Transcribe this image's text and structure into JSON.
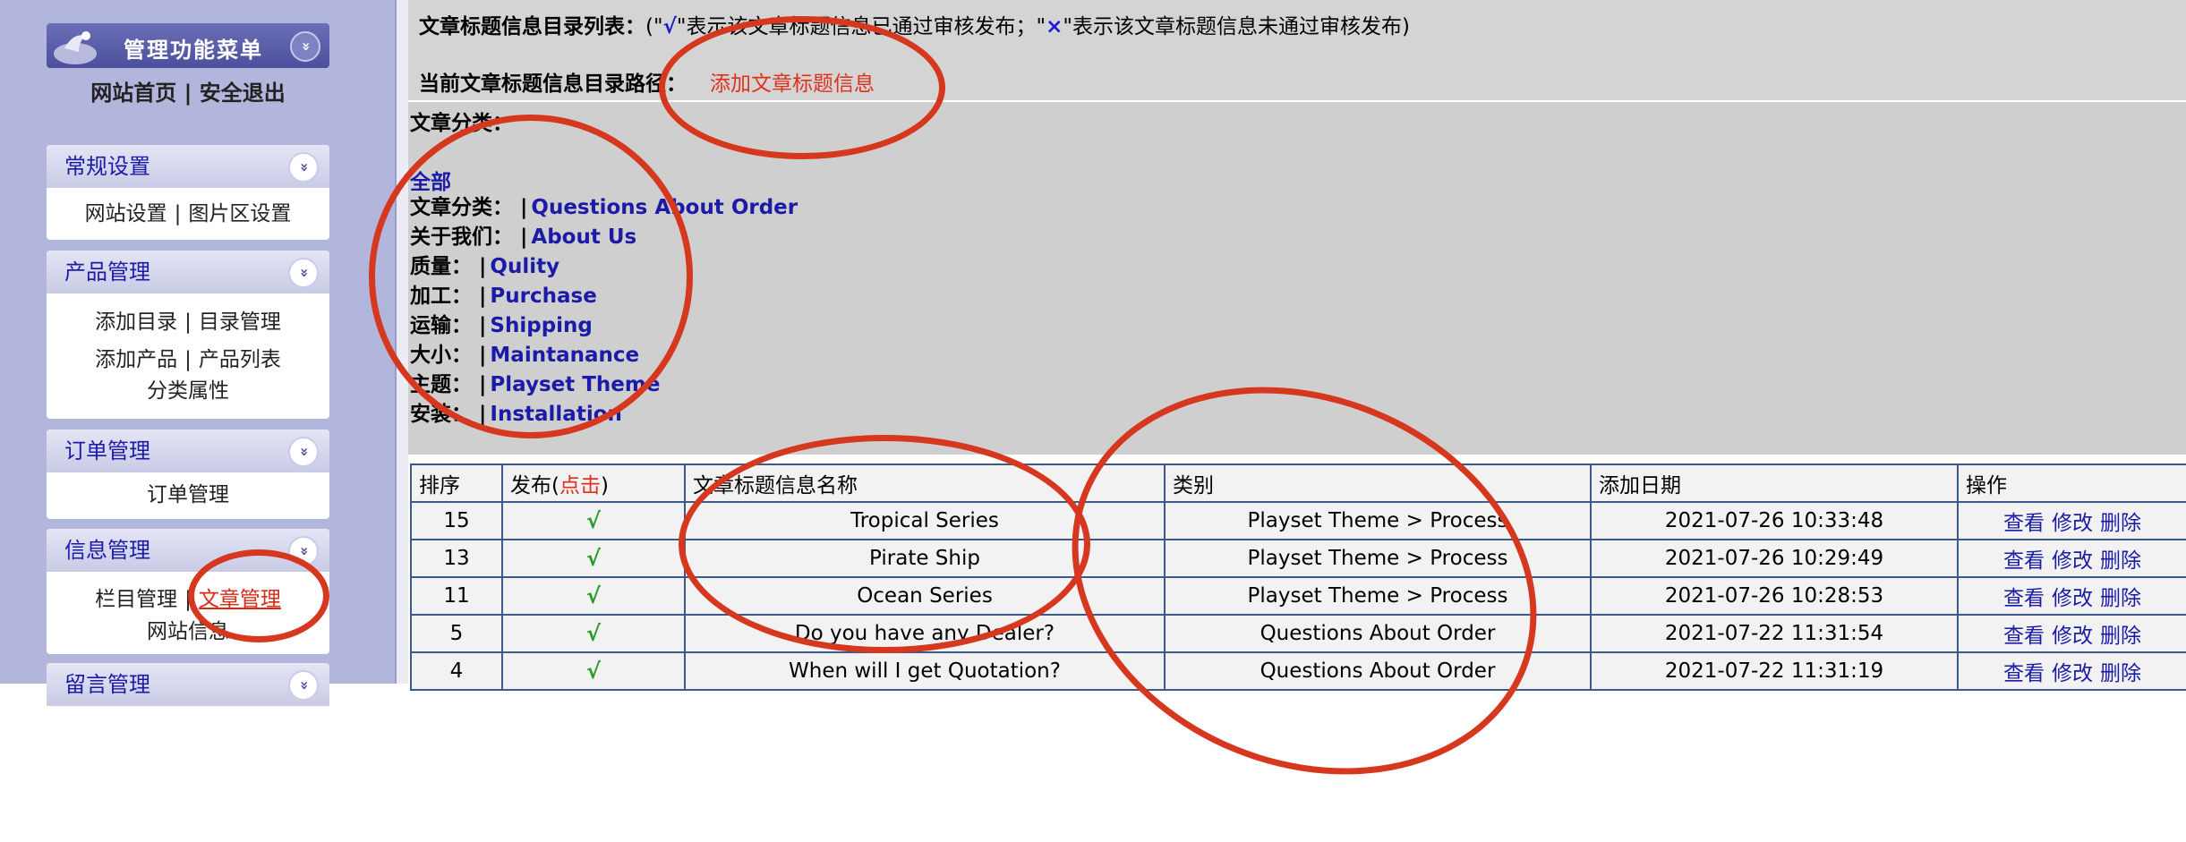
{
  "sidebar": {
    "header_title": "管理功能菜单",
    "home_link": "网站首页",
    "link_separator": "|",
    "logout_link": "安全退出",
    "sections": {
      "general": {
        "title": "常规设置",
        "links": [
          "网站设置",
          "图片区设置"
        ]
      },
      "product": {
        "title": "产品管理",
        "row1": [
          "添加目录",
          "目录管理"
        ],
        "row2": [
          "添加产品",
          "产品列表"
        ],
        "row3": "分类属性"
      },
      "order": {
        "title": "订单管理",
        "link": "订单管理"
      },
      "info": {
        "title": "信息管理",
        "links": [
          "栏目管理",
          "文章管理"
        ],
        "row2": "网站信息"
      },
      "message": {
        "title": "留言管理"
      }
    },
    "chevron": "»"
  },
  "main": {
    "legend": {
      "label": "文章标题信息目录列表：",
      "open_paren": "(\"",
      "check": "√",
      "text1": "\"表示该文章标题信息已通过审核发布；\"",
      "cross": "×",
      "text2": "\"表示该文章标题信息未通过审核发布)"
    },
    "path": {
      "label": "当前文章标题信息目录路径：",
      "add_link": "添加文章标题信息"
    },
    "categories": {
      "title": "文章分类：",
      "all": "全部",
      "rows": [
        {
          "name": "文章分类：",
          "link": "Questions About Order"
        },
        {
          "name": "关于我们：",
          "link": "About Us"
        },
        {
          "name": "质量：",
          "link": "Qulity"
        },
        {
          "name": "加工：",
          "link": "Purchase"
        },
        {
          "name": "运输：",
          "link": "Shipping"
        },
        {
          "name": "大小：",
          "link": "Maintanance"
        },
        {
          "name": "主题：",
          "link": "Playset Theme"
        },
        {
          "name": "安装：",
          "link": "Installation"
        }
      ],
      "bar": "|"
    },
    "table": {
      "headers": {
        "order": "排序",
        "publish": "发布(",
        "publish_click": "点击",
        "publish_close": ")",
        "title": "文章标题信息名称",
        "category": "类别",
        "date": "添加日期",
        "ops": "操作"
      },
      "rows": [
        {
          "order": "15",
          "published": "√",
          "title": "Tropical Series",
          "category": "Playset Theme > Process",
          "date": "2021-07-26 10:33:48"
        },
        {
          "order": "13",
          "published": "√",
          "title": "Pirate Ship",
          "category": "Playset Theme > Process",
          "date": "2021-07-26 10:29:49"
        },
        {
          "order": "11",
          "published": "√",
          "title": "Ocean Series",
          "category": "Playset Theme > Process",
          "date": "2021-07-26 10:28:53"
        },
        {
          "order": "5",
          "published": "√",
          "title": "Do you have any Dealer?",
          "category": "Questions About Order",
          "date": "2021-07-22 11:31:54"
        },
        {
          "order": "4",
          "published": "√",
          "title": "When will I get Quotation?",
          "category": "Questions About Order",
          "date": "2021-07-22 11:31:19"
        }
      ],
      "ops": {
        "view": "查看",
        "edit": "修改",
        "delete": "删除"
      }
    }
  },
  "colors": {
    "sidebar_bg": "#b3b6dc",
    "header_bg": "#4c4f9b",
    "link_blue": "#1b1ba8",
    "annotation_red": "#d6371f",
    "active_red": "#d92b16"
  }
}
